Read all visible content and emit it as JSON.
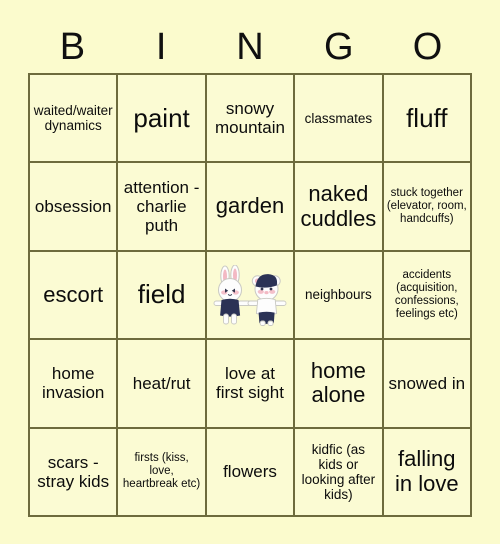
{
  "header": {
    "letters": [
      "B",
      "I",
      "N",
      "G",
      "O"
    ]
  },
  "colors": {
    "page_background": "#fbfbcd",
    "cell_background": "#fbfbd3",
    "border": "#6d6b3d",
    "text": "#0c0c0c",
    "art_navy": "#2b3255",
    "art_white": "#fdfdfd",
    "art_pink": "#f3b9c4",
    "art_outline": "#c9c9c3"
  },
  "grid": {
    "rows": 5,
    "columns": 5,
    "cells": [
      {
        "text": "waited/waiter dynamics",
        "size": "sz-sm",
        "type": "text"
      },
      {
        "text": "paint",
        "size": "sz-xl",
        "type": "text"
      },
      {
        "text": "snowy mountain",
        "size": "sz-md",
        "type": "text"
      },
      {
        "text": "classmates",
        "size": "sz-sm",
        "type": "text"
      },
      {
        "text": "fluff",
        "size": "sz-xl",
        "type": "text"
      },
      {
        "text": "obsession",
        "size": "sz-md",
        "type": "text"
      },
      {
        "text": "attention - charlie puth",
        "size": "sz-md",
        "type": "text"
      },
      {
        "text": "garden",
        "size": "sz-lg",
        "type": "text"
      },
      {
        "text": "naked cuddles",
        "size": "sz-lg",
        "type": "text"
      },
      {
        "text": "stuck together (elevator, room, handcuffs)",
        "size": "sz-xs",
        "type": "text"
      },
      {
        "text": "escort",
        "size": "sz-lg",
        "type": "text"
      },
      {
        "text": "field",
        "size": "sz-xl",
        "type": "text"
      },
      {
        "text": "",
        "size": "sz-md",
        "type": "image",
        "image_name": "bunny-and-bear-couple"
      },
      {
        "text": "neighbours",
        "size": "sz-sm",
        "type": "text"
      },
      {
        "text": "accidents (acquisition, confessions, feelings etc)",
        "size": "sz-xs",
        "type": "text"
      },
      {
        "text": "home invasion",
        "size": "sz-md",
        "type": "text"
      },
      {
        "text": "heat/rut",
        "size": "sz-md",
        "type": "text"
      },
      {
        "text": "love at first sight",
        "size": "sz-md",
        "type": "text"
      },
      {
        "text": "home alone",
        "size": "sz-lg",
        "type": "text"
      },
      {
        "text": "snowed in",
        "size": "sz-md",
        "type": "text"
      },
      {
        "text": "scars - stray kids",
        "size": "sz-md",
        "type": "text"
      },
      {
        "text": "firsts (kiss, love, heartbreak etc)",
        "size": "sz-xs",
        "type": "text"
      },
      {
        "text": "flowers",
        "size": "sz-md",
        "type": "text"
      },
      {
        "text": "kidfic (as kids or looking after kids)",
        "size": "sz-sm",
        "type": "text"
      },
      {
        "text": "falling in love",
        "size": "sz-lg",
        "type": "text"
      }
    ]
  }
}
